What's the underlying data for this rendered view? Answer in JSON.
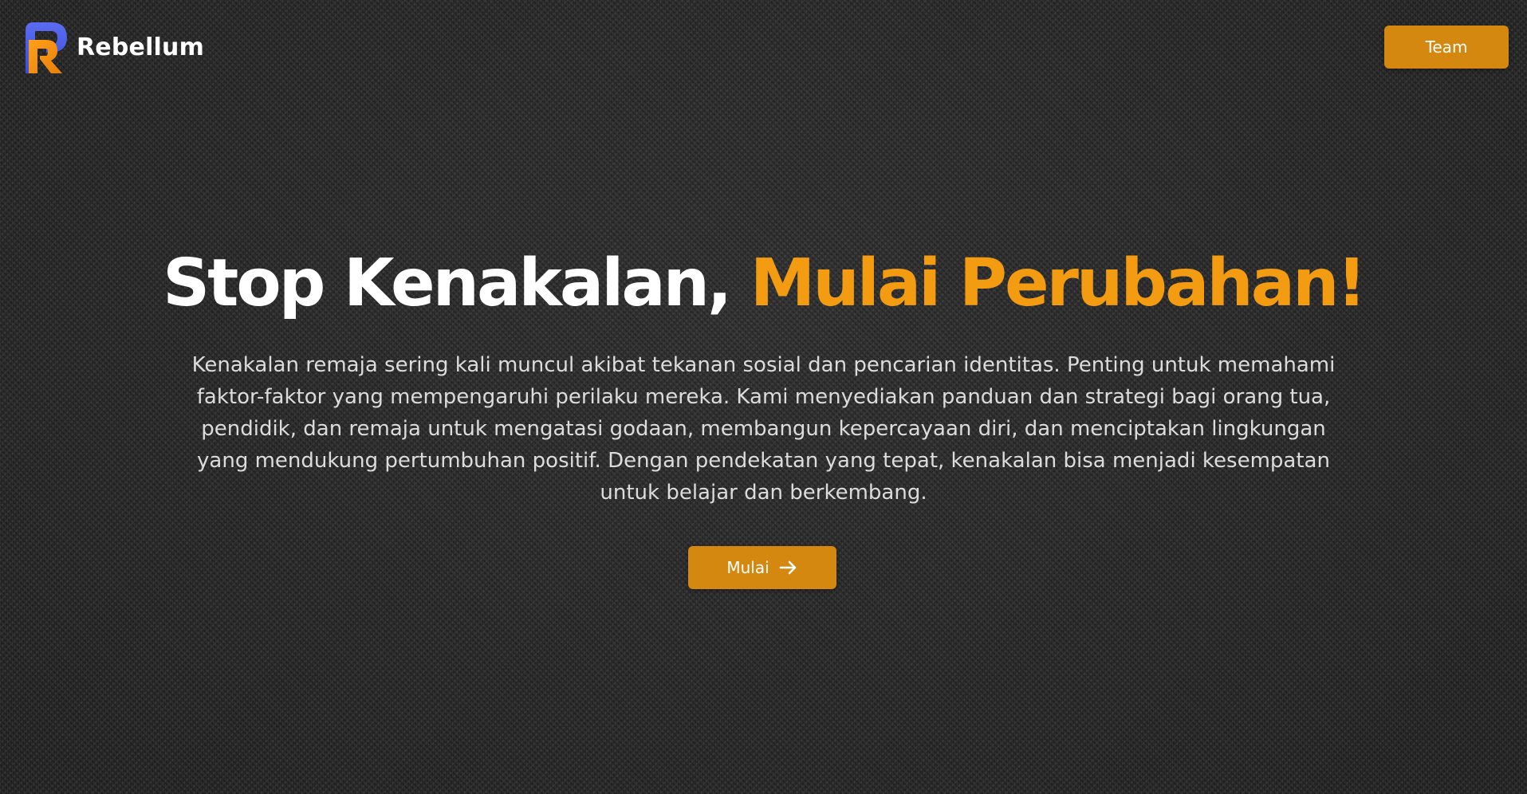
{
  "brand": {
    "name": "Rebellum",
    "logo_icon": "r-letter-logo-icon"
  },
  "nav": {
    "team_label": "Team"
  },
  "hero": {
    "title_part1": "Stop Kenakalan, ",
    "title_part2": "Mulai Perubahan!",
    "description": "Kenakalan remaja sering kali muncul akibat tekanan sosial dan pencarian identitas. Penting untuk memahami faktor-faktor yang mempengaruhi perilaku mereka. Kami menyediakan panduan dan strategi bagi orang tua, pendidik, dan remaja untuk mengatasi godaan, membangun kepercayaan diri, dan menciptakan lingkungan yang mendukung pertumbuhan positif. Dengan pendekatan yang tepat, kenakalan bisa menjadi kesempatan untuk belajar dan berkembang.",
    "cta_label": "Mulai",
    "cta_icon": "arrow-right-icon"
  },
  "colors": {
    "accent": "#f39c12",
    "button": "#d48810",
    "background": "#2b2b2b",
    "text": "#ffffff",
    "logo_blue": "#4a5ee8",
    "logo_orange": "#f39c12"
  }
}
